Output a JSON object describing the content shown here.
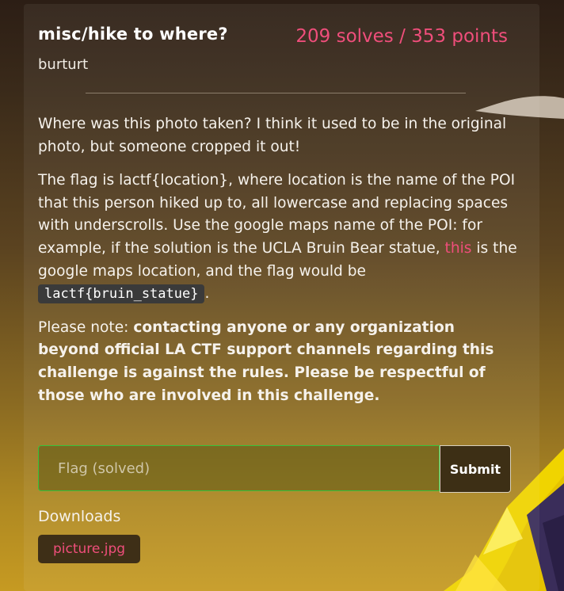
{
  "challenge": {
    "title": "misc/hike to where?",
    "score": "209 solves / 353 points",
    "author": "burturt"
  },
  "description": {
    "p1": "Where was this photo taken? I think it used to be in the original photo, but someone cropped it out!",
    "p2_text1": "The flag is lactf{location}, where location is the name of the POI that this person hiked up to, all lowercase and replacing spaces with underscrolls. Use the google maps name of the POI: for example, if the solution is the UCLA Bruin Bear statue, ",
    "p2_link": "this",
    "p2_text2": " is the google maps location, and the flag would be ",
    "p2_code": "lactf{bruin_statue}",
    "p2_end": ".",
    "p3_lead": "Please note: ",
    "p3_bold": "contacting anyone or any organization beyond official LA CTF support channels regarding this challenge is against the rules. Please be respectful of those who are involved in this challenge."
  },
  "flag_form": {
    "placeholder": "Flag (solved)",
    "submit_label": "Submit"
  },
  "downloads": {
    "label": "Downloads",
    "files": [
      {
        "name": "picture.jpg"
      }
    ]
  },
  "colors": {
    "accent_pink": "#ef4e7b",
    "input_border_green": "#37c23b"
  }
}
